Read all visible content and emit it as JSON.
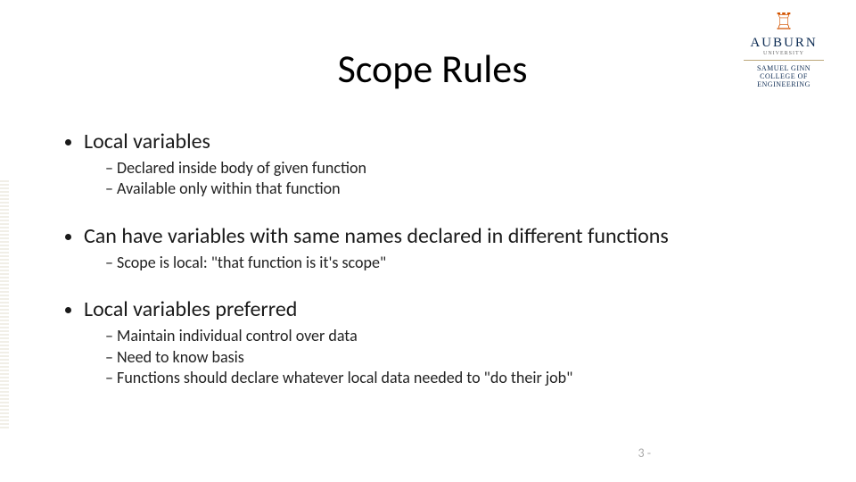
{
  "title": "Scope Rules",
  "logo": {
    "main": "AUBURN",
    "sub": "UNIVERSITY",
    "college1": "SAMUEL GINN",
    "college2": "COLLEGE OF ENGINEERING"
  },
  "bullets": {
    "b1": "Local variables",
    "b1s1": "Declared inside body of given function",
    "b1s2": "Available only within that function",
    "b2": "Can have variables with same names declared in different functions",
    "b2s1": "Scope is local: \"that function is it's scope\"",
    "b3": "Local variables preferred",
    "b3s1": "Maintain individual control over data",
    "b3s2": "Need to know basis",
    "b3s3": "Functions should declare whatever local data needed to \"do their job\""
  },
  "page_number": "3 -"
}
